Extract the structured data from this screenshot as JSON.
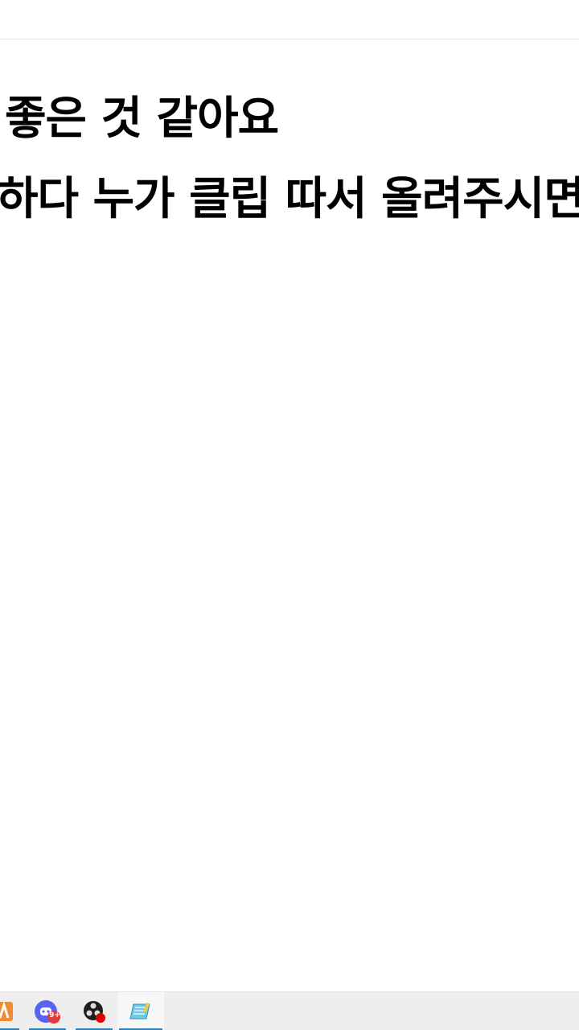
{
  "editor": {
    "lines": [
      "좋은 것 같아요",
      "하다 누가 클립 따서 올려주시면"
    ]
  },
  "taskbar": {
    "apps": [
      {
        "icon": "orange-app-icon",
        "badge": ""
      },
      {
        "icon": "chat-app-icon",
        "badge": "9+"
      },
      {
        "icon": "obs-recording-icon",
        "badge": ""
      },
      {
        "icon": "notepad-icon",
        "badge": ""
      }
    ],
    "colors": {
      "underline": "#2f7fc1",
      "badge": "#e03b3b",
      "chat": "#5865f2"
    }
  }
}
